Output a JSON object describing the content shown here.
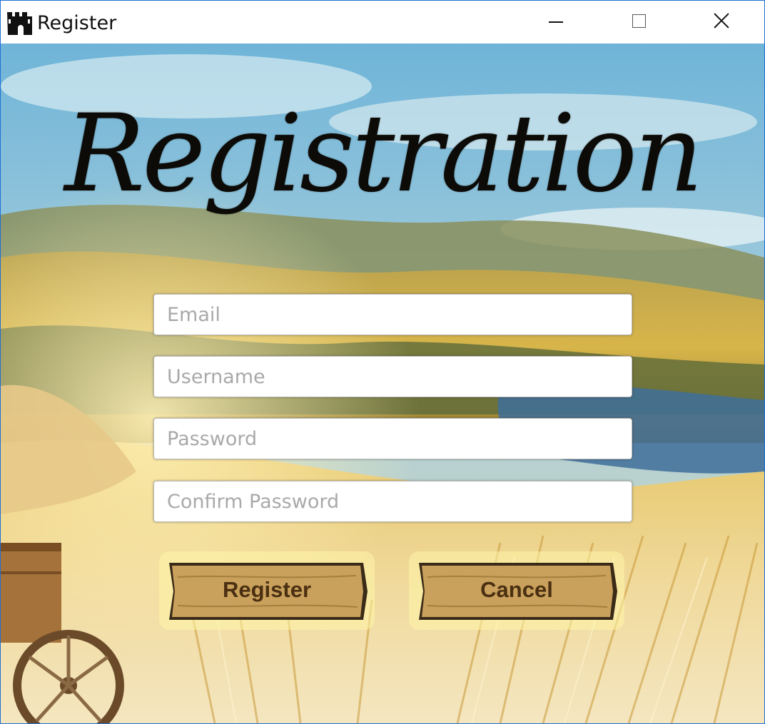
{
  "window": {
    "title": "Register",
    "icon": "castle-icon",
    "controls": [
      "minimize-icon",
      "maximize-icon",
      "close-icon"
    ]
  },
  "heading": "Registration",
  "form": {
    "email_placeholder": "Email",
    "username_placeholder": "Username",
    "password_placeholder": "Password",
    "confirm_placeholder": "Confirm Password"
  },
  "buttons": {
    "register_label": "Register",
    "cancel_label": "Cancel"
  },
  "colors": {
    "window_border": "#1f6fd6",
    "plank_wood": "#c9a15c",
    "plank_text": "#4a2f12",
    "plank_glow": "#fff6a8"
  }
}
